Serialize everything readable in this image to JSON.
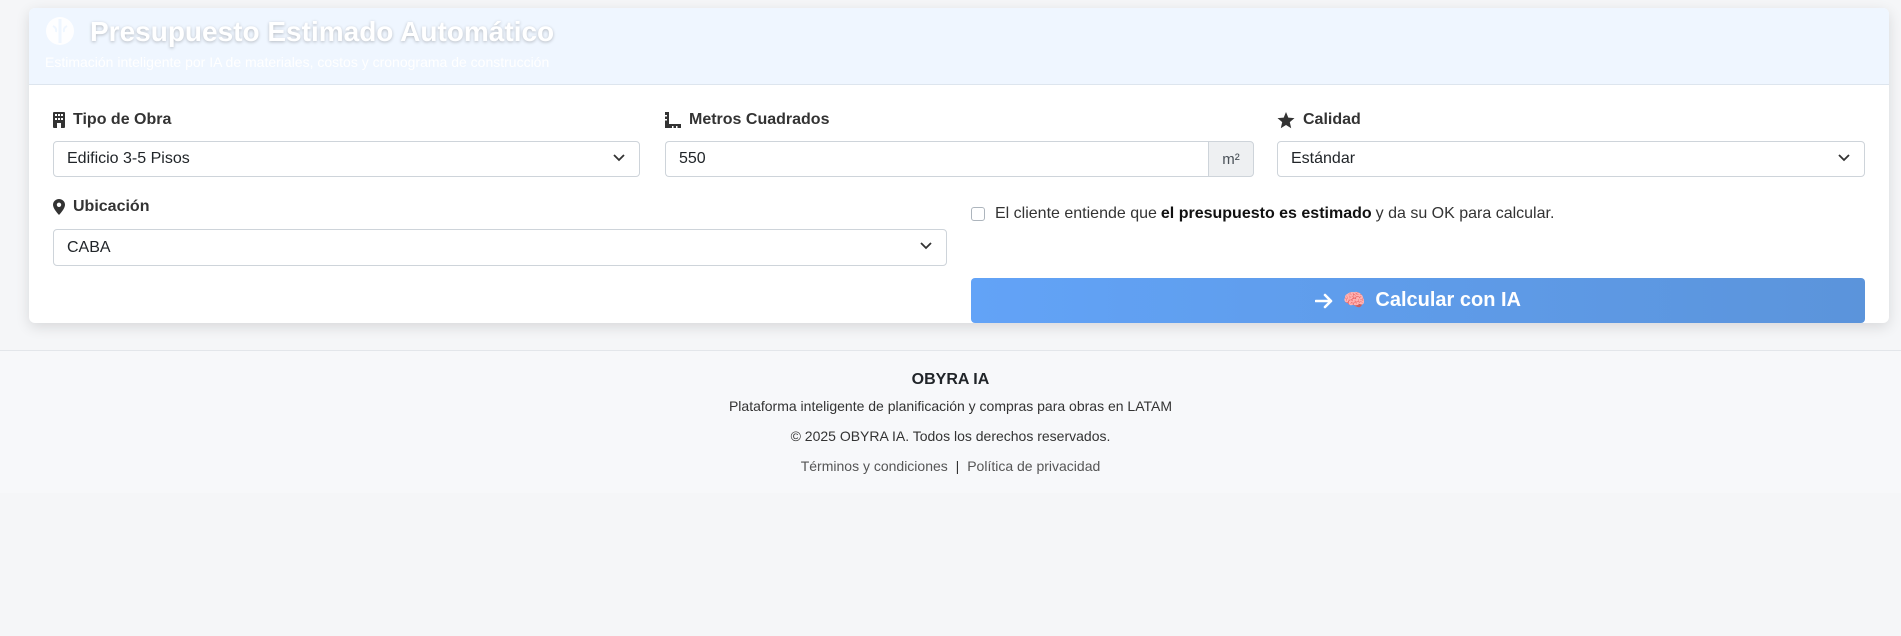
{
  "header": {
    "title": "Presupuesto Estimado Automático",
    "subtitle": "Estimación inteligente por IA de materiales, costos y cronograma de construcción",
    "icon": "brain-icon"
  },
  "form": {
    "tipo_obra": {
      "label": "Tipo de Obra",
      "icon": "building-icon",
      "value": "Edificio 3-5 Pisos"
    },
    "metros": {
      "label": "Metros Cuadrados",
      "icon": "ruler-icon",
      "value": "550",
      "unit": "m²"
    },
    "calidad": {
      "label": "Calidad",
      "icon": "star-icon",
      "value": "Estándar"
    },
    "ubicacion": {
      "label": "Ubicación",
      "icon": "map-pin-icon",
      "value": "CABA"
    },
    "consent": {
      "prefix": "El cliente entiende que",
      "bold": "el presupuesto es estimado",
      "suffix": "y da su OK para calcular."
    },
    "calc_button": {
      "arrow": "→",
      "emoji": "🧠",
      "label": "Calcular con IA"
    }
  },
  "footer": {
    "brand": "OBYRA IA",
    "tagline": "Plataforma inteligente de planificación y compras para obras en LATAM",
    "copyright": "© 2025 OBYRA IA. Todos los derechos reservados.",
    "terms": "Términos y condiciones",
    "separator": "|",
    "privacy": "Política de privacidad"
  },
  "colors": {
    "header_bg": "#eff6ff",
    "button_start": "#62a3f7",
    "button_end": "#5b94db"
  }
}
